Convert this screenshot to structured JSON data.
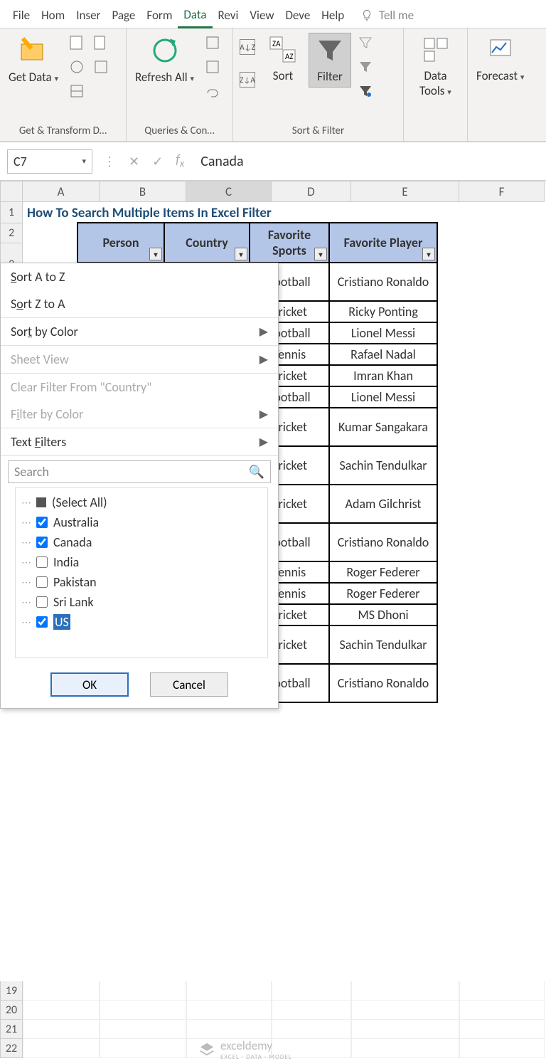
{
  "tabs": {
    "file": "File",
    "home": "Hom",
    "insert": "Inser",
    "page": "Page",
    "form": "Form",
    "data": "Data",
    "review": "Revi",
    "view": "View",
    "dev": "Deve",
    "help": "Help",
    "tellme": "Tell me"
  },
  "ribbon": {
    "getdata": "Get Data",
    "refresh": "Refresh All",
    "sort": "Sort",
    "filter": "Filter",
    "datatools": "Data Tools",
    "forecast": "Forecast",
    "grp_transform": "Get & Transform D…",
    "grp_queries": "Queries & Con…",
    "grp_sortfilter": "Sort & Filter"
  },
  "namebox": "C7",
  "formula": "Canada",
  "cols": [
    "A",
    "B",
    "C",
    "D",
    "E",
    "F"
  ],
  "title": "How To Search Multiple Items In Excel Filter",
  "headers": {
    "b": "Person",
    "c": "Country",
    "d": "Favorite Sports",
    "e": "Favorite Player"
  },
  "rows": [
    {
      "d": "Football",
      "e": "Cristiano Ronaldo",
      "tall": true
    },
    {
      "d": "Cricket",
      "e": "Ricky Ponting"
    },
    {
      "d": "Football",
      "e": "Lionel Messi"
    },
    {
      "d": "Tennis",
      "e": "Rafael Nadal"
    },
    {
      "d": "Cricket",
      "e": "Imran Khan"
    },
    {
      "d": "Football",
      "e": "Lionel Messi"
    },
    {
      "d": "Cricket",
      "e": "Kumar Sangakara",
      "tall": true
    },
    {
      "d": "Cricket",
      "e": "Sachin Tendulkar",
      "tall": true
    },
    {
      "d": "Cricket",
      "e": "Adam Gilchrist",
      "tall": true
    },
    {
      "d": "Football",
      "e": "Cristiano Ronaldo",
      "tall": true
    },
    {
      "d": "Tennis",
      "e": "Roger Federer"
    },
    {
      "d": "Tennis",
      "e": "Roger Federer"
    },
    {
      "d": "Cricket",
      "e": "MS Dhoni"
    },
    {
      "d": "Cricket",
      "e": "Sachin Tendulkar",
      "tall": true
    },
    {
      "d": "Football",
      "e": "Cristiano Ronaldo",
      "tall": true
    }
  ],
  "menu": {
    "sortaz": "Sort A to Z",
    "sortza": "Sort Z to A",
    "sortcolor": "Sort by Color",
    "sheetview": "Sheet View",
    "clear": "Clear Filter From \"Country\"",
    "filtercolor": "Filter by Color",
    "textfilters": "Text Filters",
    "search_ph": "Search",
    "items": [
      {
        "label": "(Select All)",
        "mixed": true
      },
      {
        "label": "Australia",
        "checked": true
      },
      {
        "label": "Canada",
        "checked": true
      },
      {
        "label": "India",
        "checked": false
      },
      {
        "label": "Pakistan",
        "checked": false
      },
      {
        "label": "Sri Lank",
        "checked": false
      },
      {
        "label": "US",
        "checked": true,
        "hl": true
      }
    ],
    "ok": "OK",
    "cancel": "Cancel"
  },
  "bottom_rows": [
    "19",
    "20",
    "21",
    "22"
  ],
  "watermark": "exceldemy",
  "watermark_sub": "EXCEL · DATA · MODEL"
}
